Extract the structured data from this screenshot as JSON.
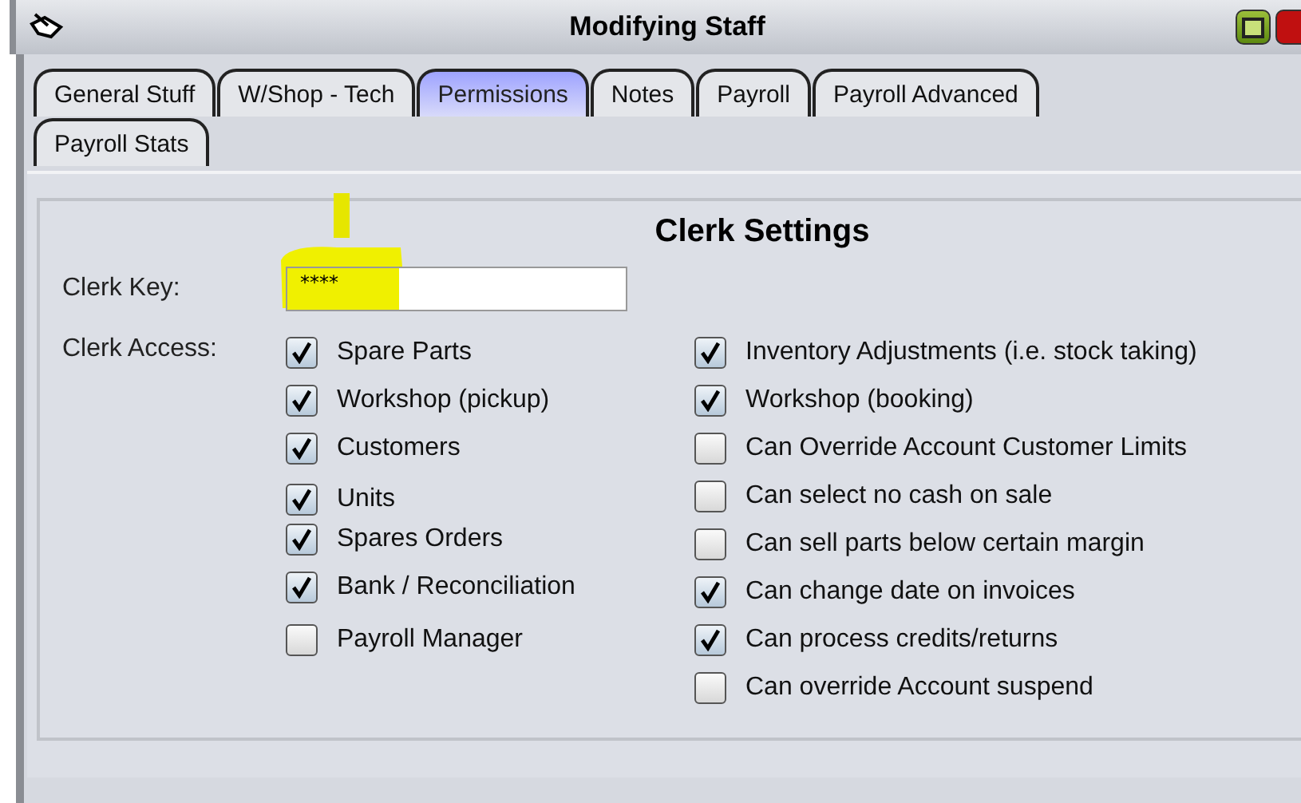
{
  "window": {
    "title": "Modifying Staff"
  },
  "tabs": [
    {
      "label": "General Stuff",
      "selected": false
    },
    {
      "label": "W/Shop - Tech",
      "selected": false
    },
    {
      "label": "Permissions",
      "selected": true
    },
    {
      "label": "Notes",
      "selected": false
    },
    {
      "label": "Payroll",
      "selected": false
    },
    {
      "label": "Payroll Advanced",
      "selected": false
    },
    {
      "label": "Payroll Stats",
      "selected": false
    }
  ],
  "group": {
    "title": "Clerk Settings",
    "key_label": "Clerk Key:",
    "key_value": "****",
    "access_label": "Clerk Access:"
  },
  "left_permissions": [
    {
      "label": "Spare Parts",
      "checked": true
    },
    {
      "label": "Workshop (pickup)",
      "checked": true
    },
    {
      "label": "Customers",
      "checked": true
    },
    {
      "label": "Units",
      "checked": true
    },
    {
      "label": "Spares Orders",
      "checked": true
    },
    {
      "label": "Bank / Reconciliation",
      "checked": true
    },
    {
      "label": "Payroll Manager",
      "checked": false
    }
  ],
  "right_permissions": [
    {
      "label": "Inventory Adjustments (i.e. stock taking)",
      "checked": true
    },
    {
      "label": "Workshop (booking)",
      "checked": true
    },
    {
      "label": "Can Override Account Customer Limits",
      "checked": false
    },
    {
      "label": "Can select no cash on sale",
      "checked": false
    },
    {
      "label": "Can sell parts below certain margin",
      "checked": false
    },
    {
      "label": "Can change date on invoices",
      "checked": true
    },
    {
      "label": "Can process credits/returns",
      "checked": true
    },
    {
      "label": "Can override Account suspend",
      "checked": false
    }
  ]
}
